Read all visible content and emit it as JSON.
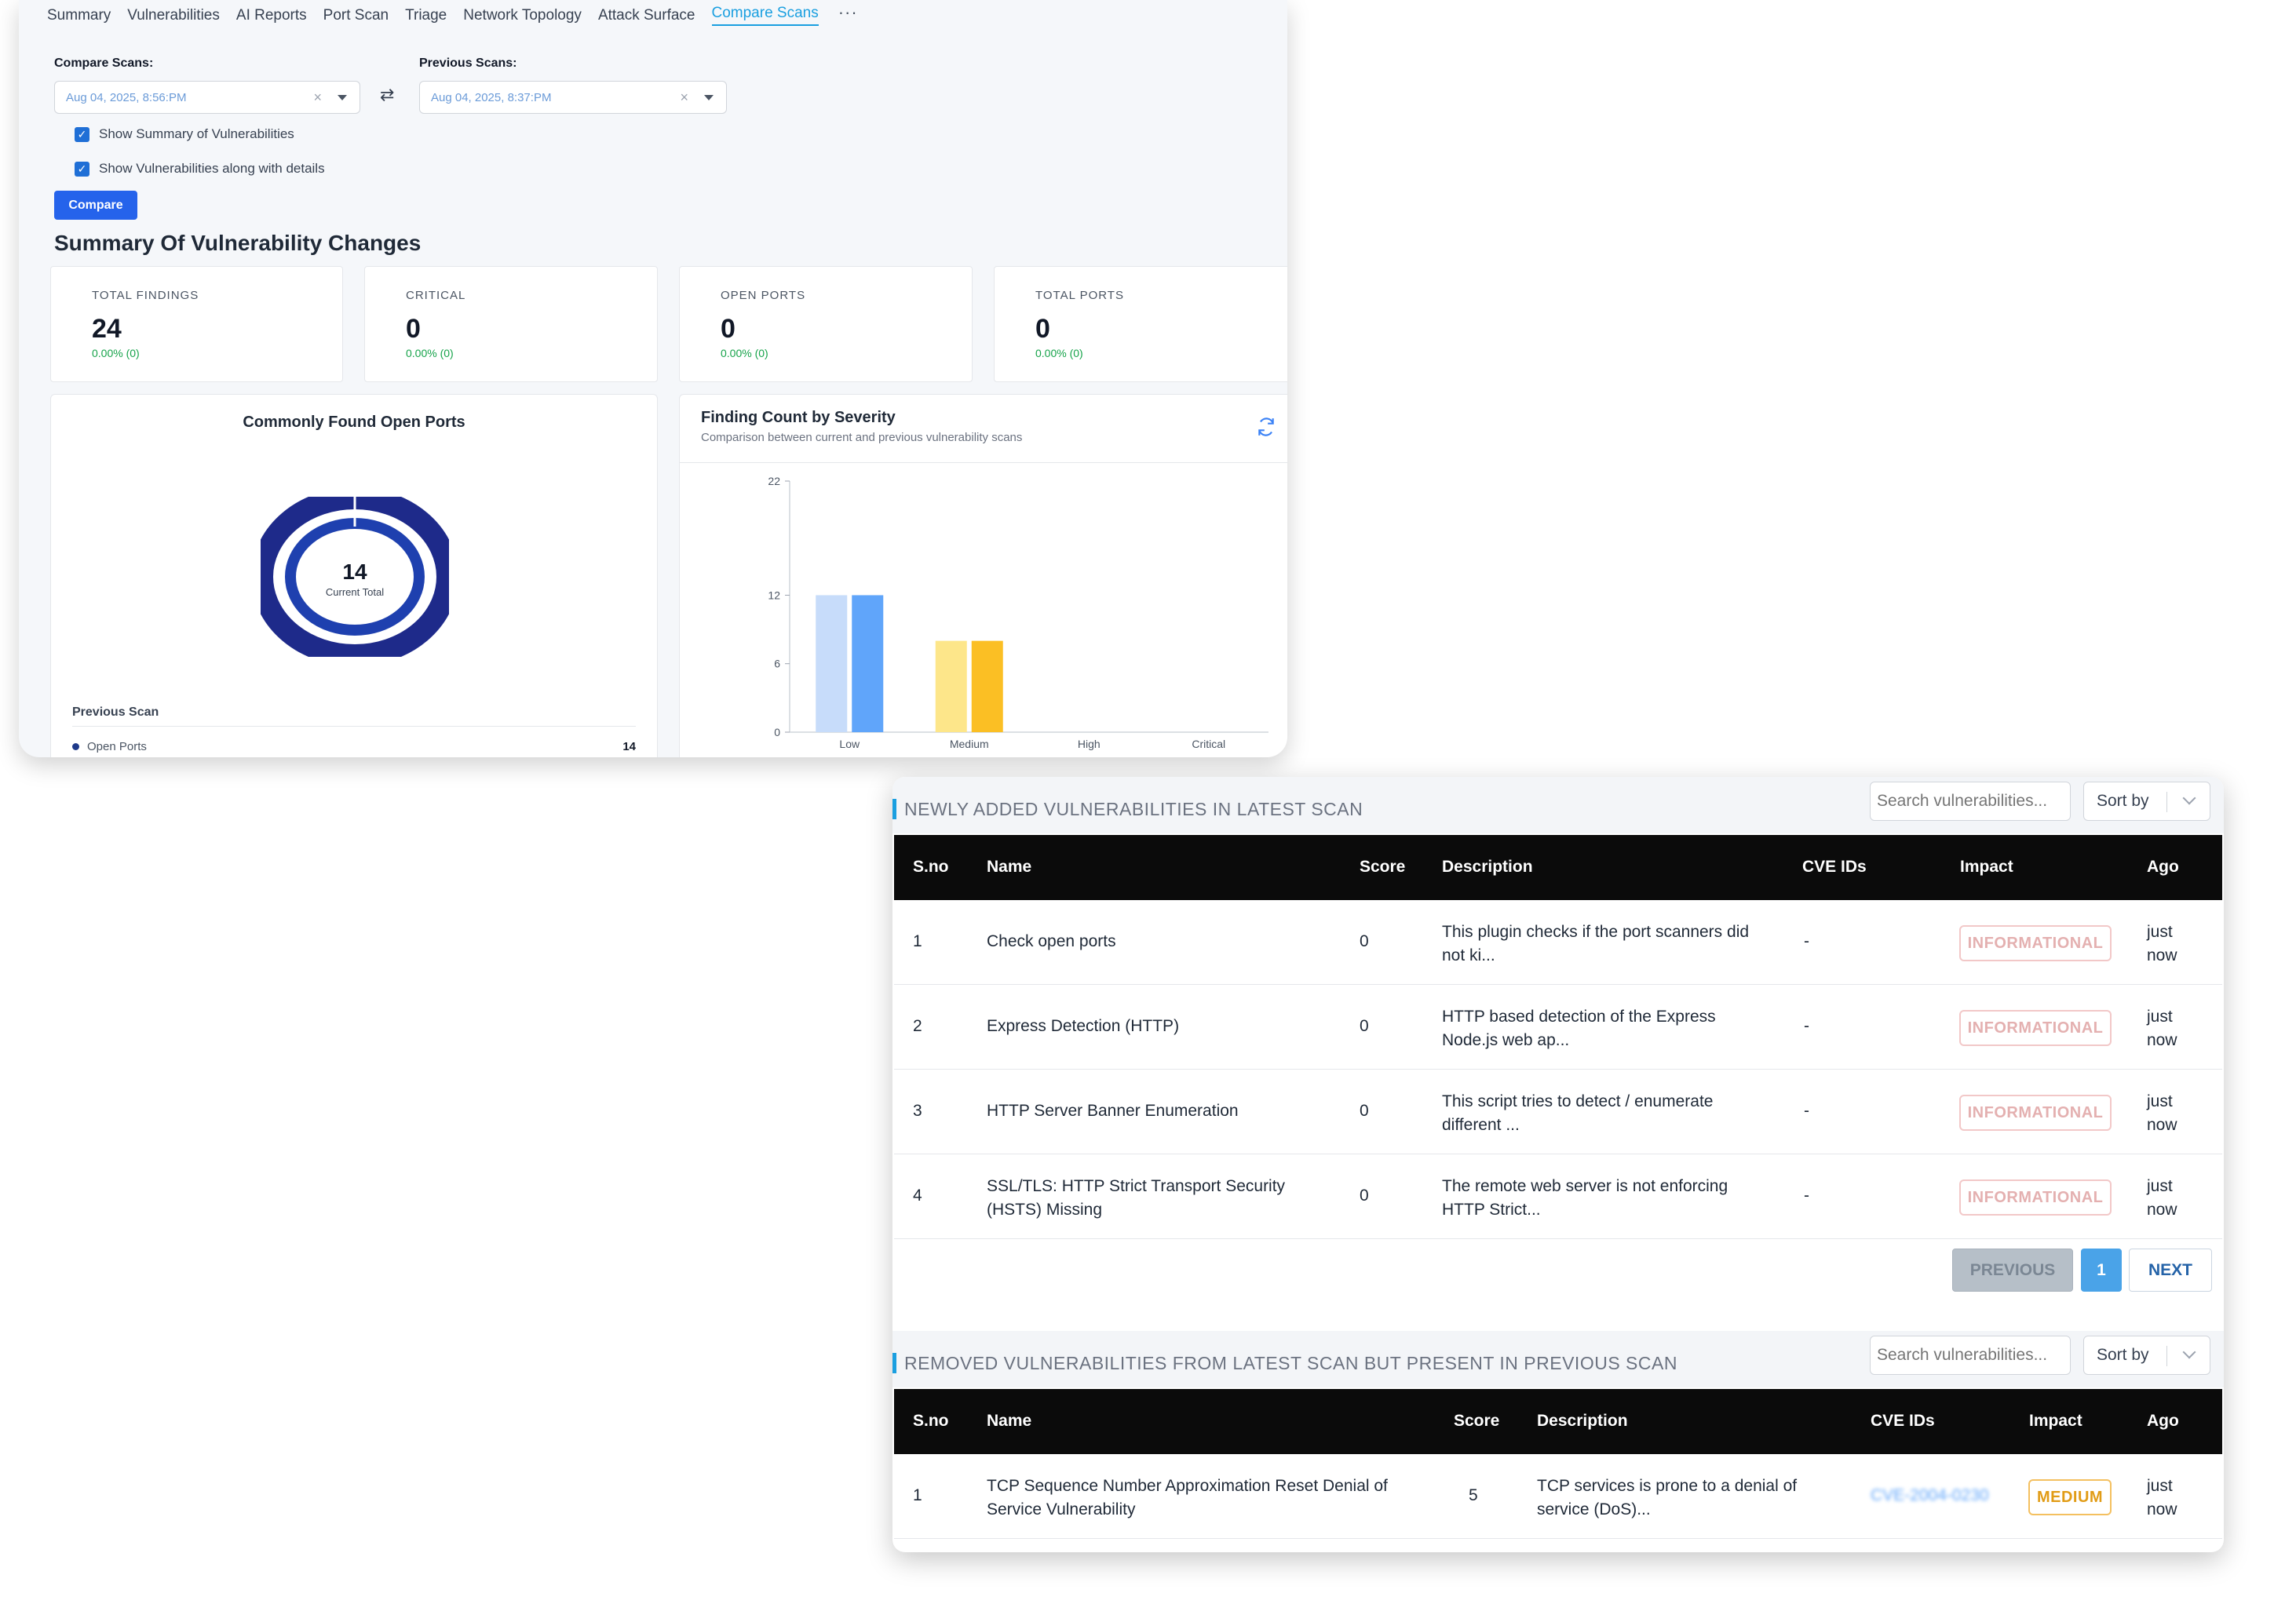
{
  "tabs": [
    {
      "label": "Summary"
    },
    {
      "label": "Vulnerabilities"
    },
    {
      "label": "AI Reports"
    },
    {
      "label": "Port Scan"
    },
    {
      "label": "Triage"
    },
    {
      "label": "Network Topology"
    },
    {
      "label": "Attack Surface"
    },
    {
      "label": "Compare Scans"
    }
  ],
  "tabs_more": "···",
  "compare": {
    "compare_label": "Compare Scans:",
    "compare_value": "Aug 04, 2025, 8:56:PM",
    "previous_label": "Previous Scans:",
    "previous_value": "Aug 04, 2025, 8:37:PM",
    "checkbox_summary": "Show Summary of Vulnerabilities",
    "checkbox_details": "Show Vulnerabilities along with details",
    "button": "Compare"
  },
  "summary": {
    "title": "Summary Of Vulnerability Changes",
    "cards": [
      {
        "title": "TOTAL FINDINGS",
        "value": "24",
        "change": "0.00% (0)"
      },
      {
        "title": "CRITICAL",
        "value": "0",
        "change": "0.00% (0)"
      },
      {
        "title": "OPEN PORTS",
        "value": "0",
        "change": "0.00% (0)"
      },
      {
        "title": "TOTAL PORTS",
        "value": "0",
        "change": "0.00% (0)"
      }
    ]
  },
  "ports_chart": {
    "title": "Commonly Found Open Ports",
    "center_value": "14",
    "center_label": "Current Total",
    "previous_label": "Previous Scan",
    "legend_label": "Open Ports",
    "legend_value": "14",
    "colors": {
      "outer": "#1e2a8a",
      "inner": "#1e40af"
    }
  },
  "severity_chart": {
    "title": "Finding Count by Severity",
    "subtitle": "Comparison between current and previous vulnerability scans",
    "refresh_icon": "refresh-icon"
  },
  "chart_data": {
    "type": "bar",
    "categories": [
      "Low",
      "Medium",
      "High",
      "Critical"
    ],
    "series": [
      {
        "values": [
          12,
          8,
          0,
          0
        ],
        "colors": [
          "#c7dcfa",
          "#fde68a",
          "#e5e7eb",
          "#e5e7eb"
        ]
      },
      {
        "values": [
          12,
          8,
          0,
          0
        ],
        "colors": [
          "#60a5fa",
          "#fbbf24",
          "#9ca3af",
          "#9ca3af"
        ]
      }
    ],
    "yticks": [
      0,
      6,
      12,
      22
    ],
    "ylim": [
      0,
      22
    ]
  },
  "newly_added": {
    "title": "NEWLY ADDED VULNERABILITIES IN LATEST SCAN",
    "search_placeholder": "Search vulnerabilities...",
    "sort_label": "Sort by",
    "headers": [
      "S.no",
      "Name",
      "Score",
      "Description",
      "CVE IDs",
      "Impact",
      "Ago"
    ],
    "rows": [
      {
        "sno": "1",
        "name": "Check open ports",
        "score": "0",
        "description": "This plugin checks if the port scanners did not ki...",
        "cve": "-",
        "impact": "INFORMATIONAL",
        "ago": "just now"
      },
      {
        "sno": "2",
        "name": "Express Detection (HTTP)",
        "score": "0",
        "description": "HTTP based detection of the Express Node.js web ap...",
        "cve": "-",
        "impact": "INFORMATIONAL",
        "ago": "just now"
      },
      {
        "sno": "3",
        "name": "HTTP Server Banner Enumeration",
        "score": "0",
        "description": "This script tries to detect / enumerate different ...",
        "cve": "-",
        "impact": "INFORMATIONAL",
        "ago": "just now"
      },
      {
        "sno": "4",
        "name": "SSL/TLS: HTTP Strict Transport Security (HSTS) Missing",
        "score": "0",
        "description": "The remote web server is not enforcing HTTP Strict...",
        "cve": "-",
        "impact": "INFORMATIONAL",
        "ago": "just now"
      }
    ],
    "pager": {
      "previous": "PREVIOUS",
      "page": "1",
      "next": "NEXT"
    }
  },
  "removed": {
    "title": "REMOVED VULNERABILITIES FROM LATEST SCAN BUT PRESENT IN PREVIOUS SCAN",
    "search_placeholder": "Search vulnerabilities...",
    "sort_label": "Sort by",
    "headers": [
      "S.no",
      "Name",
      "Score",
      "Description",
      "CVE IDs",
      "Impact",
      "Ago"
    ],
    "rows": [
      {
        "sno": "1",
        "name": "TCP Sequence Number Approximation Reset Denial of Service Vulnerability",
        "score": "5",
        "description": "TCP services is prone to a denial of service (DoS)...",
        "cve": "CVE-2004-0230",
        "impact": "MEDIUM",
        "ago": "just now"
      }
    ]
  }
}
